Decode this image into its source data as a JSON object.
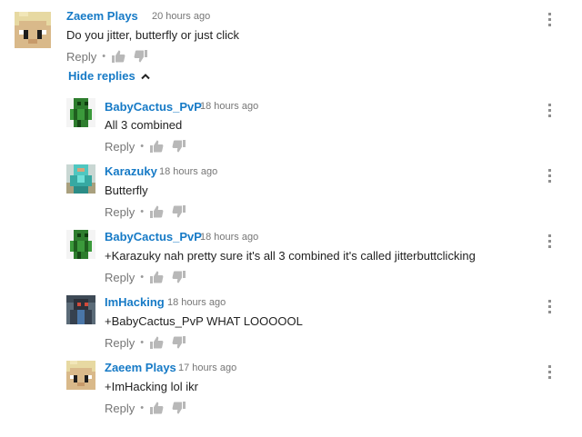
{
  "top_comment": {
    "author": "Zaeem Plays",
    "time": "20 hours ago",
    "text": "Do you jitter, butterfly or just click",
    "reply_label": "Reply",
    "avatar": "blond-blocky-face-avatar"
  },
  "hide_replies_label": "Hide replies",
  "replies": [
    {
      "author": "BabyCactus_PvP",
      "time": "18 hours ago",
      "text": "All 3 combined",
      "reply_label": "Reply",
      "avatar": "cactus-skin-avatar"
    },
    {
      "author": "Karazuky",
      "time": "18 hours ago",
      "text": "Butterfly",
      "reply_label": "Reply",
      "avatar": "diamond-armor-skin-avatar"
    },
    {
      "author": "BabyCactus_PvP",
      "time": "18 hours ago",
      "text": "+Karazuky nah pretty sure it's all 3 combined it's called jitterbuttclicking",
      "reply_label": "Reply",
      "avatar": "cactus-skin-avatar"
    },
    {
      "author": "ImHacking",
      "time": "18 hours ago",
      "text": "+BabyCactus_PvP WHAT LOOOOOL",
      "reply_label": "Reply",
      "avatar": "dark-hooded-skin-avatar"
    },
    {
      "author": "Zaeem Plays",
      "time": "17 hours ago",
      "text": "+ImHacking lol ikr",
      "reply_label": "Reply",
      "avatar": "blond-blocky-face-avatar"
    }
  ],
  "icons": {
    "like": "thumbs-up-icon",
    "dislike": "thumbs-down-icon",
    "menu": "more-vert-icon",
    "chevron": "chevron-up-icon"
  },
  "colors": {
    "author": "#167ac6",
    "meta": "#767676",
    "text": "#222222",
    "icon": "#b8b8b8"
  }
}
